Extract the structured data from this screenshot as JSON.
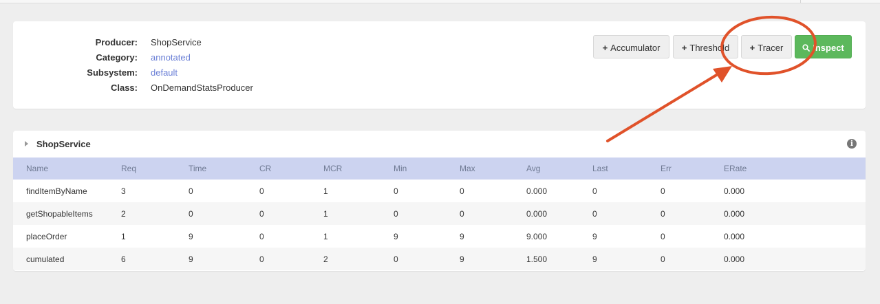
{
  "producer_info": {
    "rows": [
      {
        "label": "Producer:",
        "value": "ShopService",
        "link": false
      },
      {
        "label": "Category:",
        "value": "annotated",
        "link": true
      },
      {
        "label": "Subsystem:",
        "value": "default",
        "link": true
      },
      {
        "label": "Class:",
        "value": "OnDemandStatsProducer",
        "link": false
      }
    ]
  },
  "actions": {
    "plus_glyph": "+",
    "accumulator_label": "Accumulator",
    "threshold_label": "Threshold",
    "tracer_label": "Tracer",
    "inspect_label": "Inspect",
    "inspect_icon": "search-icon"
  },
  "stats_table": {
    "title": "ShopService",
    "info_glyph": "i",
    "columns": [
      "Name",
      "Req",
      "Time",
      "CR",
      "MCR",
      "Min",
      "Max",
      "Avg",
      "Last",
      "Err",
      "ERate"
    ],
    "rows": [
      [
        "findItemByName",
        "3",
        "0",
        "0",
        "1",
        "0",
        "0",
        "0.000",
        "0",
        "0",
        "0.000"
      ],
      [
        "getShopableItems",
        "2",
        "0",
        "0",
        "1",
        "0",
        "0",
        "0.000",
        "0",
        "0",
        "0.000"
      ],
      [
        "placeOrder",
        "1",
        "9",
        "0",
        "1",
        "9",
        "9",
        "9.000",
        "9",
        "0",
        "0.000"
      ],
      [
        "cumulated",
        "6",
        "9",
        "0",
        "2",
        "0",
        "9",
        "1.500",
        "9",
        "0",
        "0.000"
      ]
    ]
  },
  "annotation": {
    "color": "#e0522a",
    "shape": "ellipse-with-arrow",
    "target": "tracer-button"
  }
}
